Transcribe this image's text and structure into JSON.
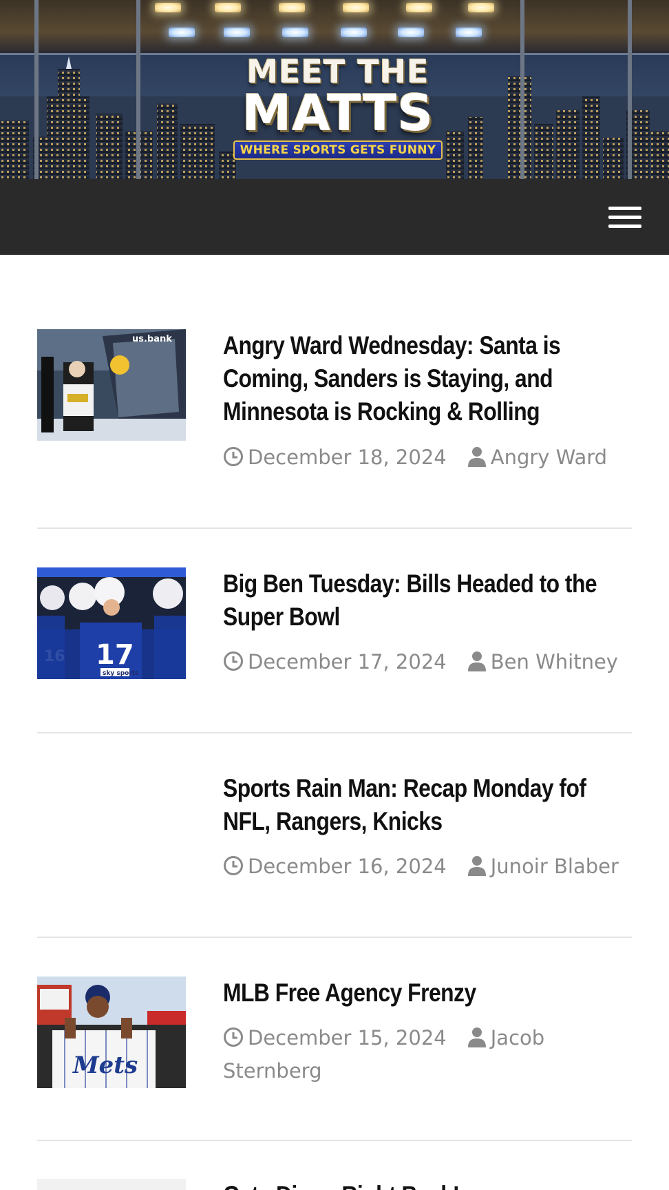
{
  "site": {
    "logo": {
      "line1": "MEET THE",
      "line2": "MATTS",
      "tagline": "WHERE SPORTS GETS FUNNY"
    }
  },
  "nav": {
    "menu_icon": "hamburger-menu-icon",
    "bar_color": "#2a2a2a"
  },
  "posts": [
    {
      "title": "Angry Ward Wednesday: Santa is Coming, Sanders is Staying, and Minnesota is Rocking & Rolling",
      "date": "December 18, 2024",
      "author": "Angry Ward",
      "has_thumbnail": true
    },
    {
      "title": "Big Ben Tuesday: Bills Headed to the Super Bowl",
      "date": "December 17, 2024",
      "author": "Ben Whitney",
      "has_thumbnail": true
    },
    {
      "title": "Sports Rain Man: Recap Monday fof NFL, Rangers, Knicks",
      "date": "December 16, 2024",
      "author": "Junoir Blaber",
      "has_thumbnail": false
    },
    {
      "title": "MLB Free Agency Frenzy",
      "date": "December 15, 2024",
      "author": "Jacob Sternberg",
      "has_thumbnail": true
    },
    {
      "title": "Gate Diary: Right Back!",
      "date": "",
      "author": "",
      "has_thumbnail": true
    }
  ],
  "colors": {
    "meta_text": "#8a8a8a",
    "divider": "#e4e4e4"
  }
}
